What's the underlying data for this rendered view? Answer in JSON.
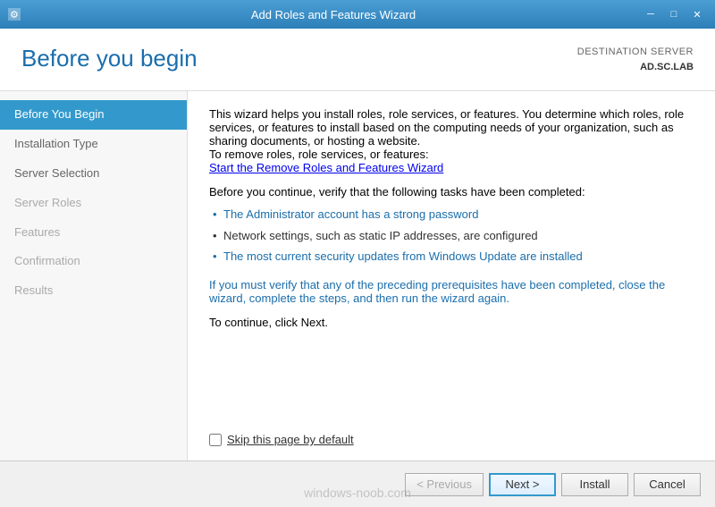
{
  "titleBar": {
    "icon": "wizard-icon",
    "title": "Add Roles and Features Wizard",
    "minimizeLabel": "─",
    "maximizeLabel": "□",
    "closeLabel": "✕"
  },
  "header": {
    "title": "Before you begin",
    "destinationLabel": "DESTINATION SERVER",
    "serverName": "AD.SC.LAB"
  },
  "sidebar": {
    "items": [
      {
        "label": "Before You Begin",
        "state": "active"
      },
      {
        "label": "Installation Type",
        "state": "normal"
      },
      {
        "label": "Server Selection",
        "state": "normal"
      },
      {
        "label": "Server Roles",
        "state": "inactive"
      },
      {
        "label": "Features",
        "state": "inactive"
      },
      {
        "label": "Confirmation",
        "state": "inactive"
      },
      {
        "label": "Results",
        "state": "inactive"
      }
    ]
  },
  "content": {
    "intro": "This wizard helps you install roles, role services, or features. You determine which roles, role services, or features to install based on the computing needs of your organization, such as sharing documents, or hosting a website.",
    "removeLabel": "To remove roles, role services, or features:",
    "removeLink": "Start the Remove Roles and Features Wizard",
    "verifyLabel": "Before you continue, verify that the following tasks have been completed:",
    "bullets": [
      {
        "text": "The Administrator account has a strong password",
        "color": "blue"
      },
      {
        "text": "Network settings, such as static IP addresses, are configured",
        "color": "black"
      },
      {
        "text": "The most current security updates from Windows Update are installed",
        "color": "blue"
      }
    ],
    "prerequisiteNote": "If you must verify that any of the preceding prerequisites have been completed, close the wizard, complete the steps, and then run the wizard again.",
    "continueNote": "To continue, click Next.",
    "checkboxLabel": "Skip this page by default"
  },
  "footer": {
    "previousLabel": "< Previous",
    "nextLabel": "Next >",
    "installLabel": "Install",
    "cancelLabel": "Cancel"
  },
  "watermark": "windows-noob.com"
}
